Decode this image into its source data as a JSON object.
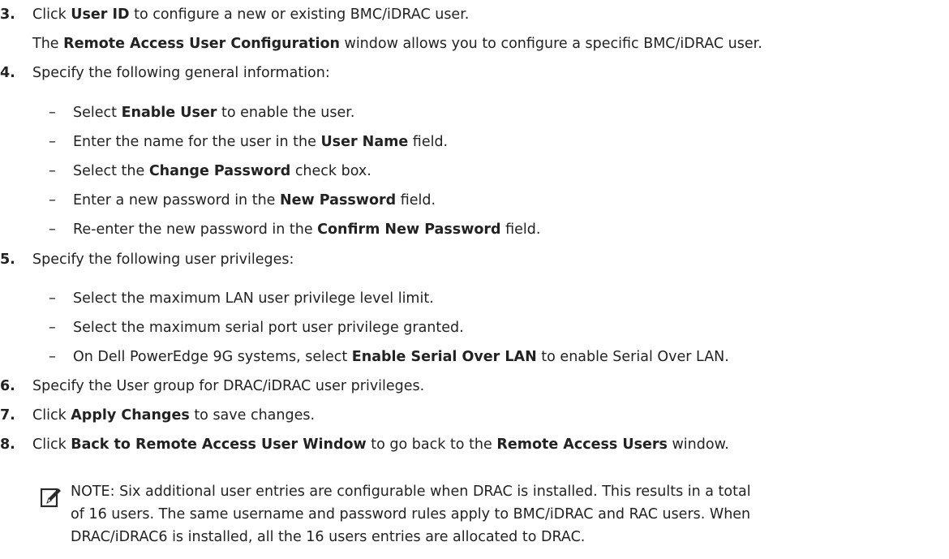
{
  "steps": {
    "s3": {
      "num": "3.",
      "a": "Click ",
      "b": "User ID",
      "c": " to configure a new or existing BMC/iDRAC user."
    },
    "s3sub": {
      "a": "The ",
      "b": "Remote Access User Configuration",
      "c": " window allows you to configure a specific BMC/iDRAC user."
    },
    "s4": {
      "num": "4.",
      "text": "Specify the following general information:"
    },
    "s4items": [
      {
        "dash": "–",
        "a": "Select ",
        "b": "Enable User",
        "c": " to enable the user."
      },
      {
        "dash": "–",
        "a": "Enter the name for the user in the ",
        "b": "User Name",
        "c": " field."
      },
      {
        "dash": "–",
        "a": "Select the ",
        "b": "Change Password",
        "c": " check box."
      },
      {
        "dash": "–",
        "a": "Enter a new password in the ",
        "b": "New Password",
        "c": " field."
      },
      {
        "dash": "–",
        "a": "Re-enter the new password in the ",
        "b": "Confirm New Password",
        "c": " field."
      }
    ],
    "s5": {
      "num": "5.",
      "text": "Specify the following user privileges:"
    },
    "s5items": [
      {
        "dash": "–",
        "a": "Select the maximum LAN user privilege level limit."
      },
      {
        "dash": "–",
        "a": "Select the maximum serial port user privilege granted."
      },
      {
        "dash": "–",
        "a": "On Dell PowerEdge 9G systems, select ",
        "b": "Enable Serial Over LAN",
        "c": " to enable Serial Over LAN."
      }
    ],
    "s6": {
      "num": "6.",
      "text": "Specify the User group for DRAC/iDRAC user privileges."
    },
    "s7": {
      "num": "7.",
      "a": "Click ",
      "b": "Apply Changes",
      "c": " to save changes."
    },
    "s8": {
      "num": "8.",
      "a": "Click ",
      "b": "Back to Remote Access User Window",
      "c": " to go back to the ",
      "d": "Remote Access Users",
      "e": " window."
    }
  },
  "note": {
    "icon": "pencil-note-icon",
    "label": "NOTE:",
    "line1": " Six additional user entries are configurable when DRAC is installed. This results in a total",
    "line2": "of 16 users. The same username and password rules apply to BMC/iDRAC and RAC users. When",
    "line3": "DRAC/iDRAC6 is installed, all the 16 users entries are allocated to DRAC."
  }
}
